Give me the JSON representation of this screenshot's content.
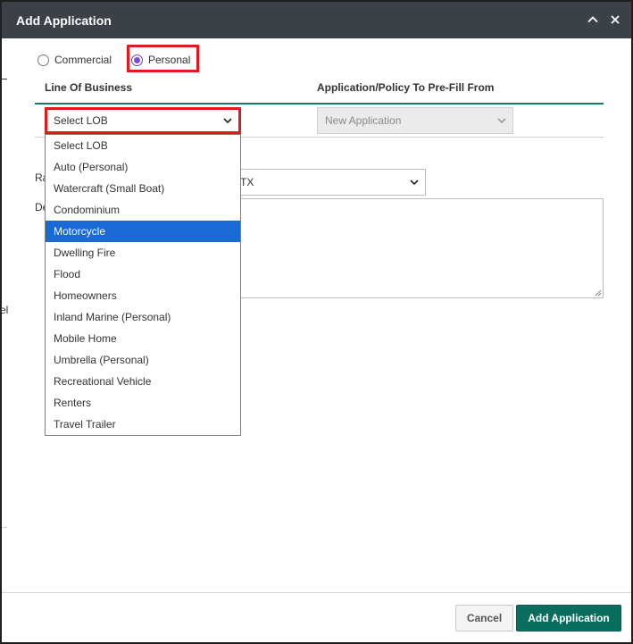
{
  "dialog": {
    "title": "Add Application",
    "collapse_icon": "chevron-up-icon",
    "close_icon": "close-icon"
  },
  "type_radios": {
    "commercial_label": "Commercial",
    "personal_label": "Personal",
    "selected": "Personal"
  },
  "headers": {
    "line_of_business": "Line Of Business",
    "prefill": "Application/Policy To Pre-Fill From"
  },
  "lob_select": {
    "value": "Select LOB",
    "options": [
      "Select LOB",
      "Auto (Personal)",
      "Watercraft (Small Boat)",
      "Condominium",
      "Motorcycle",
      "Dwelling Fire",
      "Flood",
      "Homeowners",
      "Inland Marine (Personal)",
      "Mobile Home",
      "Umbrella (Personal)",
      "Recreational Vehicle",
      "Renters",
      "Travel Trailer"
    ],
    "highlighted": "Motorcycle"
  },
  "prefill_select": {
    "value": "New Application"
  },
  "partial_fields": {
    "state_label_fragment": "Ra",
    "state_value_fragment": "TX",
    "description_label_fragment": "De",
    "left_edge_fragment": "el"
  },
  "footer": {
    "cancel_label": "Cancel",
    "add_label": "Add Application"
  },
  "colors": {
    "titlebar": "#3b4146",
    "accent": "#0a6d5d",
    "highlight": "#1a6ad6",
    "callout_red": "#e01b1b",
    "radio_purple": "#7a50c7"
  }
}
